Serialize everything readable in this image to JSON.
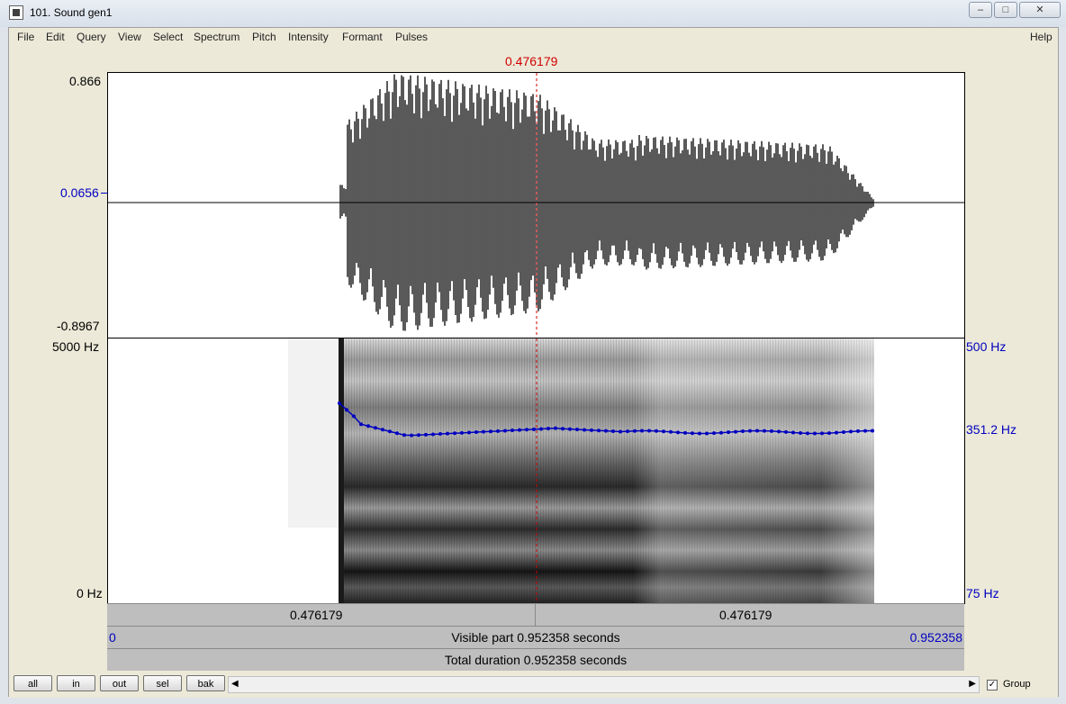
{
  "window": {
    "title": "101. Sound gen1"
  },
  "menu": [
    "File",
    "Edit",
    "Query",
    "View",
    "Select",
    "Spectrum",
    "Pitch",
    "Intensity",
    "Formant",
    "Pulses"
  ],
  "help_label": "Help",
  "cursor": {
    "time_label": "0.476179"
  },
  "waveform": {
    "ymax": "0.866",
    "ycursor": "0.0656",
    "ymin": "-0.8967"
  },
  "spectrogram": {
    "fmax": "5000 Hz",
    "fmin": "0 Hz"
  },
  "pitch": {
    "max": "500 Hz",
    "current": "351.2 Hz",
    "min": "75 Hz"
  },
  "bars": {
    "left_time": "0.476179",
    "right_time": "0.476179",
    "visible_start": "0",
    "visible_text": "Visible part 0.952358 seconds",
    "visible_end": "0.952358",
    "total_text": "Total duration 0.952358 seconds"
  },
  "buttons": [
    "all",
    "in",
    "out",
    "sel",
    "bak"
  ],
  "group": {
    "label": "Group",
    "checked": true
  },
  "colors": {
    "cursor": "#d00000",
    "pitch": "#0000c0",
    "waveform": "#000000"
  }
}
